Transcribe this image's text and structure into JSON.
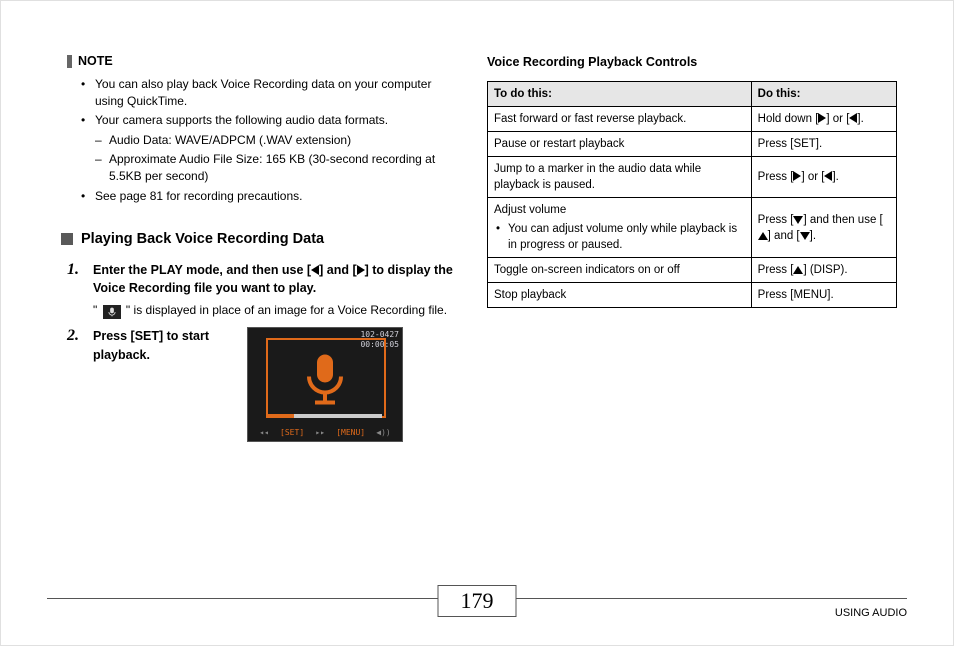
{
  "note": {
    "label": "NOTE",
    "items": {
      "i0": "You can also play back Voice Recording data on your computer using QuickTime.",
      "i1": "Your camera supports the following audio data formats.",
      "i2": "See page 81 for recording precautions."
    },
    "sub": {
      "s0": "Audio Data: WAVE/ADPCM (.WAV extension)",
      "s1": "Approximate Audio File Size: 165 KB (30-second recording at 5.5KB per second)"
    }
  },
  "section_heading": "Playing Back Voice Recording Data",
  "steps": {
    "s1": {
      "num": "1.",
      "title_a": "Enter the PLAY mode, and then use [",
      "title_b": "] and [",
      "title_c": "] to display the Voice Recording file you want to play.",
      "desc_a": "\" ",
      "desc_b": " \" is displayed in place of an image for a Voice Recording file."
    },
    "s2": {
      "num": "2.",
      "title": "Press [SET] to start playback."
    }
  },
  "lcd": {
    "line1": "102-0427",
    "line2": "00:00:05",
    "c0": "◂◂",
    "c1": "[SET]",
    "c2": "▸▸",
    "c3": "[MENU]",
    "c4": "◀))"
  },
  "table": {
    "title": "Voice Recording Playback Controls",
    "h0": "To do this:",
    "h1": "Do this:",
    "r0": {
      "c0": "Fast forward or fast reverse playback.",
      "c1a": "Hold down [",
      "c1b": "] or [",
      "c1c": "]."
    },
    "r1": {
      "c0": "Pause or restart playback",
      "c1": "Press [SET]."
    },
    "r2": {
      "c0": "Jump to a marker in the audio data while playback is paused.",
      "c1a": "Press [",
      "c1b": "] or [",
      "c1c": "]."
    },
    "r3": {
      "c0": "Adjust volume",
      "li": "You can adjust volume only while playback is in progress or paused.",
      "c1a": "Press [",
      "c1b": "] and then use [",
      "c1c": "] and [",
      "c1d": "]."
    },
    "r4": {
      "c0": "Toggle on-screen indicators on or off",
      "c1a": "Press [",
      "c1b": "] (DISP)."
    },
    "r5": {
      "c0": "Stop playback",
      "c1": "Press [MENU]."
    }
  },
  "footer": {
    "page": "179",
    "section": "USING AUDIO"
  }
}
